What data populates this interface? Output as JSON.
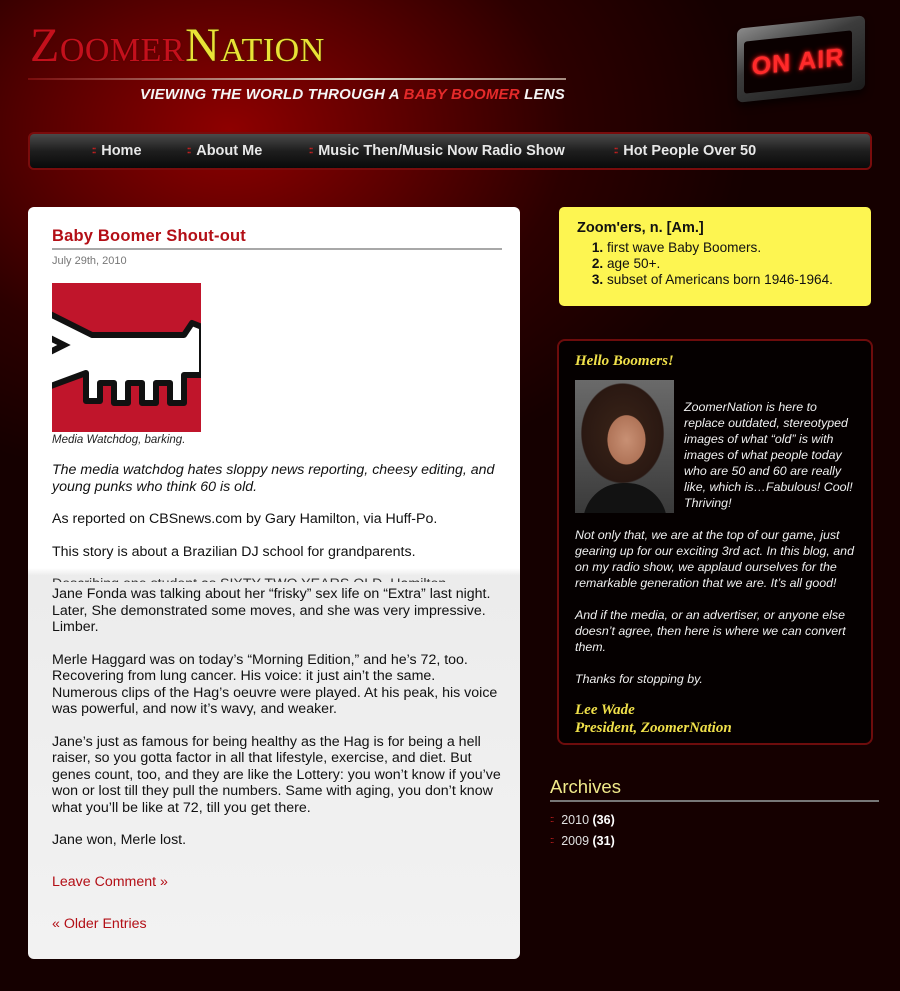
{
  "header": {
    "logo_part1": "Zoomer",
    "logo_part2": "Nation",
    "tagline_part1": "VIEWING THE WORLD THROUGH A",
    "tagline_accent": "BABY BOOMER",
    "tagline_part2": "LENS",
    "onair_sign": "ON AIR"
  },
  "nav": {
    "items": [
      {
        "label": "Home"
      },
      {
        "label": "About Me"
      },
      {
        "label": "Music Then/Music Now Radio Show"
      },
      {
        "label": "Hot People Over 50"
      }
    ]
  },
  "post": {
    "title": "Baby Boomer Shout-out",
    "date": "July 29th, 2010",
    "image_caption": "Media Watchdog, barking.",
    "lead": "The media watchdog hates sloppy news reporting, cheesy editing, and young punks who think 60 is old.",
    "paragraphs": [
      "As reported on CBSnews.com by Gary Hamilton, via Huff-Po.",
      "This story is about a Brazilian DJ school for grandparents.",
      "Describing one student as SIXTY-TWO YEARS OLD, Hamilton",
      "Jane Fonda was talking about her “frisky” sex life on “Extra” last night. Later, She demonstrated some moves, and she was very impressive. Limber.",
      "Merle Haggard was on today’s “Morning Edition,” and he’s 72, too. Recovering from lung cancer. His voice: it just ain’t the same. Numerous clips of the Hag’s oeuvre were played. At his peak, his voice was powerful, and now it’s wavy, and weaker.",
      "Jane’s just as famous for being healthy as the Hag is for being a hell raiser, so you gotta factor in all that lifestyle, exercise, and diet. But genes count, too, and they are like the Lottery: you won’t know if you’ve won or lost till they pull the numbers. Same with aging, you don’t know what you’ll be like at 72, till you get there.",
      "Jane won, Merle lost."
    ],
    "leave_comment": "Leave Comment »",
    "older_entries": "« Older Entries"
  },
  "definition": {
    "title": "Zoom'ers, n. [Am.]",
    "items": [
      "first wave Baby Boomers.",
      "age 50+.",
      "subset of Americans born 1946-1964."
    ]
  },
  "welcome": {
    "heading": "Hello Boomers!",
    "paragraphs": [
      "ZoomerNation is here to replace outdated, stereotyped images of what “old” is with images of what people today who are 50 and 60 are really like, which is…Fabulous! Cool! Thriving!",
      "Not only that, we are at the top of our game, just gearing up for our exciting 3rd act. In this blog, and on my radio show, we applaud ourselves for the remarkable generation that we are. It’s all good!",
      "And if the media, or an advertiser, or anyone else doesn’t agree, then here is where we can convert them.",
      "Thanks for stopping by."
    ],
    "signature_name": "Lee Wade",
    "signature_title": "President, ZoomerNation"
  },
  "archives": {
    "title": "Archives",
    "items": [
      {
        "year": "2010",
        "count": "(36)"
      },
      {
        "year": "2009",
        "count": "(31)"
      }
    ]
  },
  "colors": {
    "accent_red": "#b30f16",
    "logo_yellow": "#e9e336",
    "definition_bg": "#fdf551"
  }
}
